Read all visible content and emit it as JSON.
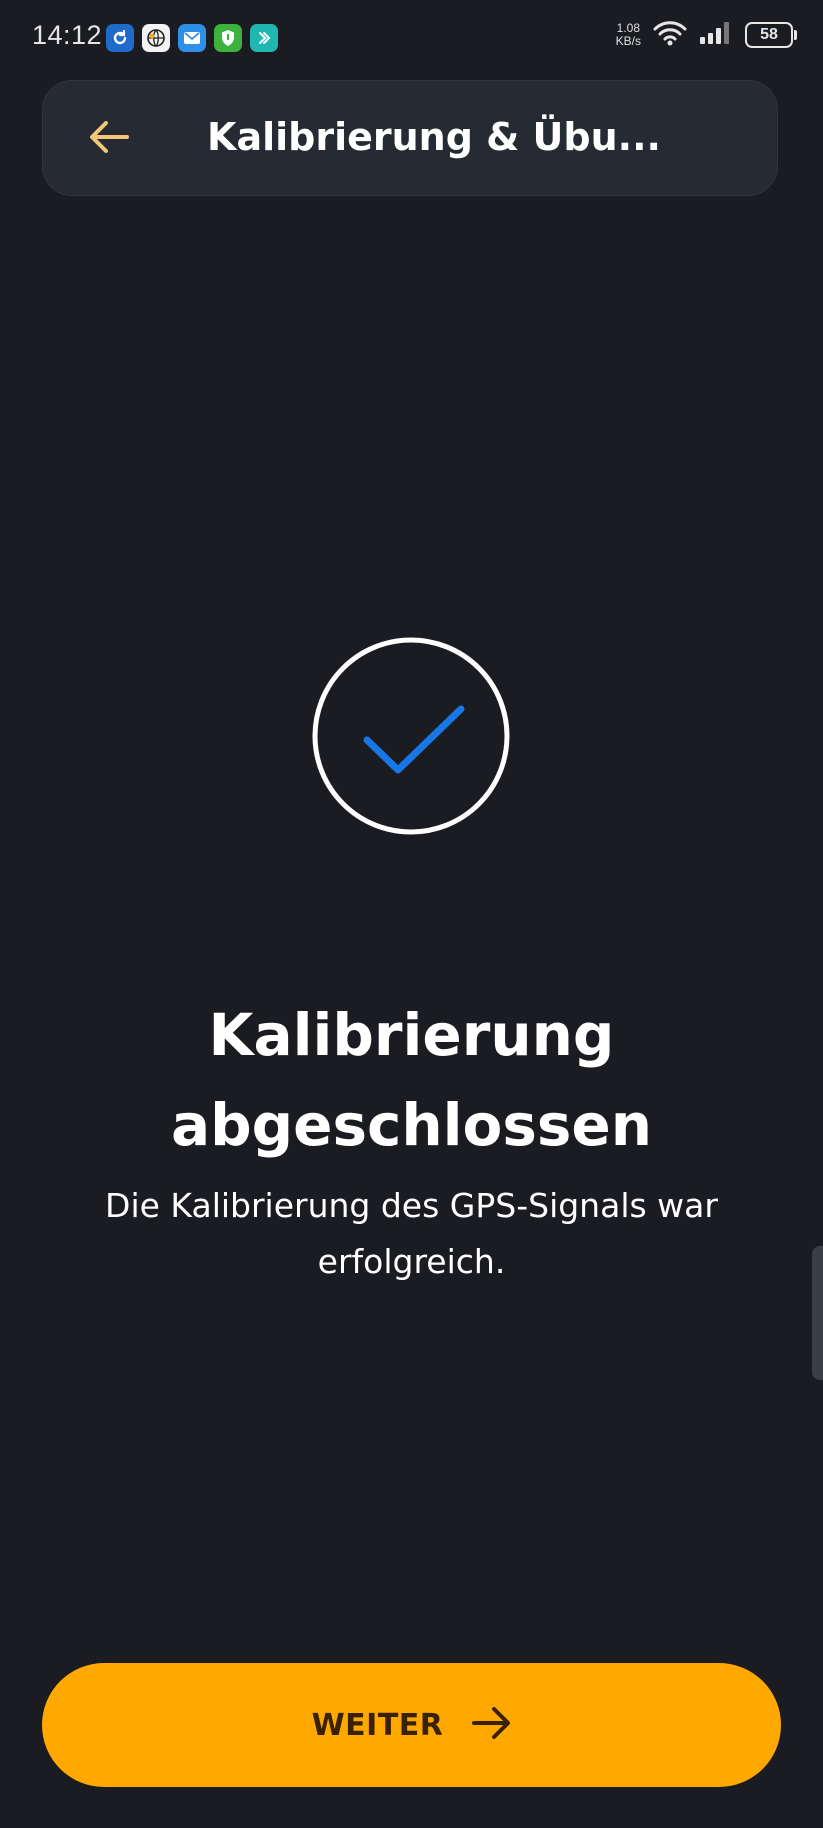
{
  "status_bar": {
    "time": "14:12",
    "net_speed_value": "1.08",
    "net_speed_unit": "KB/s",
    "battery": "58",
    "notification_icons": [
      "sync-icon",
      "globe-icon",
      "mail-icon",
      "shield-icon",
      "app-icon"
    ]
  },
  "header": {
    "title": "Kalibrierung & Übu..."
  },
  "success": {
    "title": "Kalibrierung abgeschlossen",
    "message": "Die Kalibrierung des GPS-Signals war erfolgreich."
  },
  "continue_button": {
    "label": "WEITER"
  },
  "colors": {
    "background": "#1a1c21",
    "header_bg": "#262a32",
    "accent": "#ffa800",
    "back_arrow": "#f5c67a",
    "check": "#1877e6"
  }
}
